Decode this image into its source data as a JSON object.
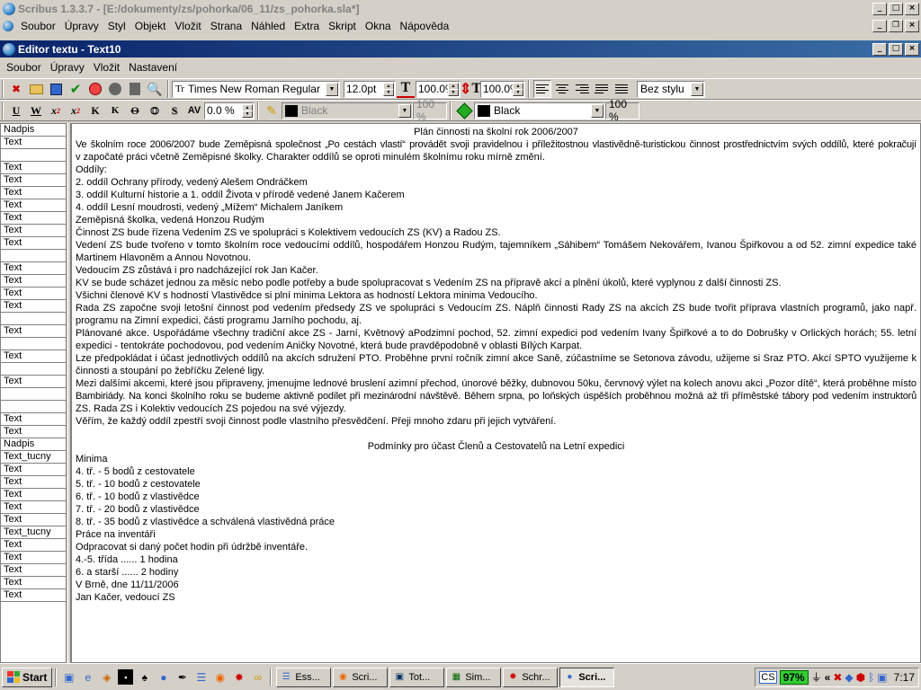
{
  "app": {
    "title": "Scribus 1.3.3.7 - [E:/dokumenty/zs/pohorka/06_11/zs_pohorka.sla*]",
    "menu": [
      "Soubor",
      "Úpravy",
      "Styl",
      "Objekt",
      "Vložit",
      "Strana",
      "Náhled",
      "Extra",
      "Skript",
      "Okna",
      "Nápověda"
    ]
  },
  "editor_window": {
    "title": "Editor textu - Text10",
    "menu": [
      "Soubor",
      "Úpravy",
      "Vložit",
      "Nastavení"
    ]
  },
  "toolbar1": {
    "font": "Times New Roman Regular",
    "size": "12.0pt",
    "scale_h": "100.0%",
    "scale_v": "100.0%",
    "para_style": "Bez stylu"
  },
  "toolbar2": {
    "tracking": "0.0 %",
    "stroke_color": "Black",
    "stroke_shade": "100 %",
    "fill_color": "Black",
    "fill_shade": "100 %"
  },
  "styles": [
    "Nadpis",
    "Text",
    "",
    "Text",
    "Text",
    "Text",
    "Text",
    "Text",
    "Text",
    "Text",
    "",
    "Text",
    "Text",
    "Text",
    "Text",
    "",
    "Text",
    "",
    "Text",
    "",
    "Text",
    "",
    "",
    "Text",
    "Text",
    "Nadpis",
    "Text_tucny",
    "Text",
    "Text",
    "Text",
    "Text",
    "Text",
    "Text_tucny",
    "Text",
    "Text",
    "Text",
    "Text",
    "Text"
  ],
  "lines": [
    {
      "t": "Plán činnosti na školní rok 2006/2007",
      "a": "c"
    },
    {
      "t": "Ve školním roce 2006/2007 bude Zeměpisná společnost „Po cestách vlastí“ provádět svoji pravidelnou i příležitostnou vlastivědně-turistickou činnost prostřednictvím svých oddílů, které pokračují",
      "a": "j"
    },
    {
      "t": "v započaté práci včetně Zeměpisné školky. Charakter oddílů se oproti minulém školnímu roku mírně změní.",
      "a": "l"
    },
    {
      "t": "Oddíly:",
      "a": "l"
    },
    {
      "t": "2. oddíl Ochrany přírody, vedený Alešem Ondráčkem",
      "a": "l"
    },
    {
      "t": "3. oddíl Kulturní historie a 1. oddíl Života v přírodě vedené Janem Kačerem",
      "a": "l"
    },
    {
      "t": "4. oddíl Lesní moudrosti, vedený „Mížem“ Michalem Janíkem",
      "a": "l"
    },
    {
      "t": "Zeměpisná školka, vedená Honzou Rudým",
      "a": "l"
    },
    {
      "t": "Činnost ZS bude řízena Vedením ZS ve spolupráci s Kolektivem vedoucích ZS (KV) a Radou ZS.",
      "a": "l"
    },
    {
      "t": "Vedení ZS bude tvořeno v tomto školním roce vedoucími oddílů, hospodářem Honzou Rudým, tajemníkem „Sáhibem“ Tomášem Nekovářem, Ivanou Špiřkovou a od 52. zimní expedice také",
      "a": "j"
    },
    {
      "t": "Martinem Hlavoněm a Annou Novotnou.",
      "a": "l"
    },
    {
      "t": "Vedoucím ZS zůstává i pro nadcházející rok Jan Kačer.",
      "a": "l"
    },
    {
      "t": "KV se bude scházet jednou za měsíc nebo podle potřeby a bude spolupracovat s Vedením ZS na přípravě akcí a plnění úkolů, které vyplynou z další činnosti ZS.",
      "a": "l"
    },
    {
      "t": "Všichni členové KV s hodností Vlastivědce si plní minima Lektora as hodností Lektora minima Vedoucího.",
      "a": "l"
    },
    {
      "t": "Rada ZS započne svoji letošní činnost pod vedením předsedy ZS ve spolupráci s Vedoucím ZS. Náplň činnosti Rady ZS na akcích ZS bude tvořit příprava vlastních programů, jako např.",
      "a": "j"
    },
    {
      "t": "programu na Zimní expedici, části programu Jarního pochodu, aj.",
      "a": "l"
    },
    {
      "t": "Plánované akce. Uspořádáme všechny tradiční akce ZS - Jarní, Květnový aPodzimní pochod, 52. zimní expedici pod vedením Ivany Špiřkové a to do Dobrušky v Orlických horách; 55. letní",
      "a": "j"
    },
    {
      "t": "expedici - tentokráte pochodovou, pod vedením Aničky Novotné, která bude pravděpodobně v oblasti Bílých Karpat.",
      "a": "l"
    },
    {
      "t": "Lze předpokládat i účast jednotlivých oddílů na akcích sdružení PTO. Proběhne první ročník zimní akce Saně, zúčastníme se Setonova závodu, užijeme si Sraz PTO. Akcí SPTO využijeme k",
      "a": "j"
    },
    {
      "t": "činnosti a stoupání po žebříčku Zelené ligy.",
      "a": "l"
    },
    {
      "t": "Mezi dalšími akcemi, které jsou připraveny, jmenujme lednové bruslení azimní přechod, únorové běžky, dubnovou 50ku, červnový výlet na kolech anovu akci „Pozor dítě“, která proběhne místo",
      "a": "j"
    },
    {
      "t": "Bambiriády. Na konci školního roku se budeme aktivně podílet při mezinárodní návštěvě. Během srpna, po loňských úspěších proběhnou možná až tři příměstské tábory pod vedením instruktorů",
      "a": "j"
    },
    {
      "t": "ZS. Rada ZS i Kolektiv vedoucích ZS pojedou na své výjezdy.",
      "a": "l"
    },
    {
      "t": "Věřím, že každý oddíl zpestří svoji činnost podle vlastního přesvědčení. Přeji mnoho zdaru při jejich vytváření.",
      "a": "l"
    },
    {
      "t": "",
      "a": "l"
    },
    {
      "t": "Podmínky pro účast Členů a Cestovatelů na Letní expedici",
      "a": "c"
    },
    {
      "t": "Minima",
      "a": "l"
    },
    {
      "t": "4. tř. - 5 bodů z cestovatele",
      "a": "l"
    },
    {
      "t": "5. tř. - 10 bodů z cestovatele",
      "a": "l"
    },
    {
      "t": "6. tř. - 10 bodů z vlastivědce",
      "a": "l"
    },
    {
      "t": "7. tř. - 20 bodů z vlastivědce",
      "a": "l"
    },
    {
      "t": "8. tř. - 35 bodů z vlastivědce a schválená vlastivědná práce",
      "a": "l"
    },
    {
      "t": "Práce na inventáři",
      "a": "l"
    },
    {
      "t": "Odpracovat si daný počet hodin při údržbě inventáře.",
      "a": "l"
    },
    {
      "t": "4.-5. třída ...... 1 hodina",
      "a": "l"
    },
    {
      "t": "6. a starší ...... 2 hodiny",
      "a": "l"
    },
    {
      "t": "V Brně, dne 11/11/2006",
      "a": "l"
    },
    {
      "t": "Jan Kačer, vedoucí ZS",
      "a": "l"
    }
  ],
  "taskbar": {
    "start": "Start",
    "tasks": [
      {
        "label": "Ess...",
        "icon": "document-icon"
      },
      {
        "label": "Scri...",
        "icon": "firefox-icon"
      },
      {
        "label": "Tot...",
        "icon": "floppy-icon"
      },
      {
        "label": "Sim...",
        "icon": "chart-icon"
      },
      {
        "label": "Schr...",
        "icon": "gimp-icon"
      },
      {
        "label": "Scri...",
        "icon": "scribus-icon",
        "active": true
      }
    ],
    "battery": "97%",
    "clock": "7:17"
  },
  "colors": {
    "title_active": "#0a246a",
    "battery": "#33cc33"
  }
}
